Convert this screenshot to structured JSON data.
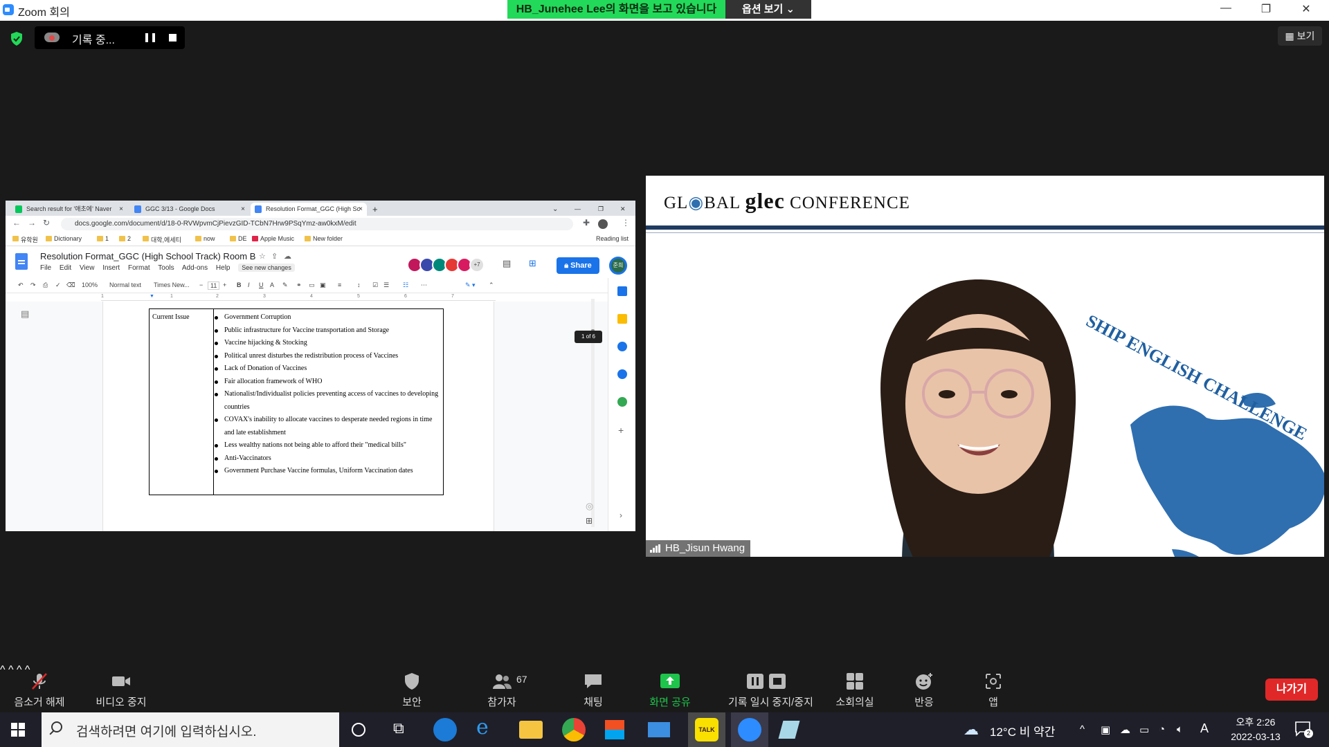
{
  "window": {
    "title": "Zoom 회의",
    "share_banner": "HB_Junehee Lee의 화면을 보고 있습니다",
    "view_options": "옵션 보기 ⌄",
    "min": "—",
    "max": "❐",
    "close": "✕"
  },
  "recording": {
    "label": "기록 중..."
  },
  "view_button": "보기",
  "shared_screen": {
    "tabs": [
      {
        "label": "Search result for '애초에' Naver",
        "favicon_color": "#03c75a"
      },
      {
        "label": "GGC 3/13 - Google Docs",
        "favicon_color": "#4285f4"
      },
      {
        "label": "Resolution Format_GGC (High Sc",
        "favicon_color": "#4285f4"
      }
    ],
    "url": "docs.google.com/document/d/18-0-RVWpvmCjPievzGID-TCbN7Hrw9PSqYmz-aw0kxM/edit",
    "bookmarks": [
      "유학원",
      "Dictionary",
      "1",
      "2",
      "대학,에세티",
      "now",
      "DE",
      "Apple Music",
      "New folder"
    ],
    "reading_list": "Reading list",
    "doc_title": "Resolution Format_GGC (High School Track) Room B",
    "menu": [
      "File",
      "Edit",
      "View",
      "Insert",
      "Format",
      "Tools",
      "Add-ons",
      "Help"
    ],
    "see_changes": "See new changes",
    "collaborators_extra": "+7",
    "share_label": "Share",
    "me_avatar": "준희",
    "toolbar": {
      "zoom": "100%",
      "style": "Normal text",
      "font": "Times New...",
      "size": "11"
    },
    "ruler_ticks": [
      "1",
      "1",
      "2",
      "3",
      "4",
      "5",
      "6",
      "7"
    ],
    "table": {
      "left_cell": "Current Issue",
      "items": [
        "Government Corruption",
        "Public infrastructure for Vaccine transportation and Storage",
        "Vaccine hijacking & Stocking",
        "Political unrest disturbes the redistribution process of Vaccines",
        "Lack of Donation of Vaccines",
        "Fair allocation framework of WHO",
        "Nationalist/Individualist policies preventing access of vaccines to developing countries",
        "COVAX's inability to allocate vaccines to desperate needed regions in time and late establishment",
        "Less wealthy nations not being able to afford their \"medical bills\"",
        "Anti-Vaccinators",
        "Government Purchase Vaccine formulas, Uniform Vaccination dates"
      ]
    },
    "page_indicator": "1 of 6"
  },
  "video": {
    "header_left": "GL",
    "header_obal": "BAL",
    "header_glec": "glec",
    "header_right": "CONFERENCE",
    "background_text": "SHIP ENGLISH CHALLENGE",
    "participant_name": "HB_Jisun Hwang"
  },
  "controls": {
    "unmute": "음소거 해제",
    "stop_video": "비디오 중지",
    "security": "보안",
    "participants": "참가자",
    "participant_count": "67",
    "chat": "채팅",
    "share_screen": "화면 공유",
    "pause_recording": "기록 일시 중지/중지",
    "breakout": "소회의실",
    "reactions": "반응",
    "apps": "앱",
    "leave": "나가기"
  },
  "taskbar": {
    "search_placeholder": "검색하려면 여기에 입력하십시오.",
    "weather": "12°C  비 약간",
    "ime": "A",
    "time": "오후 2:26",
    "date": "2022-03-13",
    "notification_count": "2"
  },
  "colors": {
    "banner_green": "#23d959",
    "share_green": "#1ec44b",
    "leave_red": "#e02828",
    "docs_blue": "#1a73e8",
    "navy_rule": "#1f3b61",
    "globe_blue": "#2f6fb0"
  }
}
